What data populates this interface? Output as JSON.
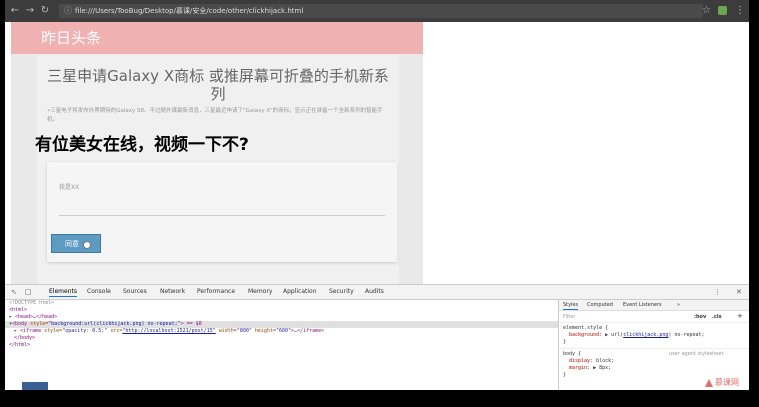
{
  "browser": {
    "url": "file:///Users/TooBug/Desktop/慕课/安全/code/other/clickhijack.html",
    "back_icon": "arrow-left-icon",
    "forward_icon": "arrow-right-icon",
    "reload_icon": "reload-icon"
  },
  "page": {
    "logo": "昨日头条",
    "headline": "三星申请Galaxy X商标 或推屏幕可折叠的手机新系列",
    "summary": "•三星电子将发布外界期待的Galaxy S8。不过随外媒最新消息，三星最近申请了\"Galaxy X\"的商标，显示正在准备一个全新系列的智能手机。",
    "lure_text": "有位美女在线，视频一下不?",
    "form": {
      "field_label": "我是XX",
      "submit_label": "同意"
    }
  },
  "devtools": {
    "tabs": [
      "Elements",
      "Console",
      "Sources",
      "Network",
      "Performance",
      "Memory",
      "Application",
      "Security",
      "Audits"
    ],
    "active_tab": "Elements",
    "dom": {
      "doctype": "<!DOCTYPE html>",
      "html_open": "<html>",
      "head": "<head>…</head>",
      "body_tag": "<body",
      "body_attr": "style=",
      "body_val": "\"background:url(clickhijack.png) no-repeat;\"",
      "body_end": "> == $0",
      "iframe_tag": "<iframe",
      "iframe_style_attr": "style=",
      "iframe_style_val": "\"opacity: 0.5;\"",
      "iframe_src_attr": "src=",
      "iframe_src_val": "\"http://localhost:1521/post/15\"",
      "iframe_width_attr": "width=",
      "iframe_width_val": "\"800\"",
      "iframe_height_attr": "height=",
      "iframe_height_val": "\"600\"",
      "iframe_end": ">…</iframe>",
      "body_close": "</body>",
      "html_close": "</html>"
    },
    "styles_panel": {
      "tabs": [
        "Styles",
        "Computed",
        "Event Listeners",
        "»"
      ],
      "filter_placeholder": "Filter",
      "hov": ":hov",
      "cls": ".cls",
      "plus": "+",
      "element_style_selector": "element.style {",
      "bg_prop": "background",
      "bg_prefix": ": ▶ url(",
      "bg_link": "clickhijack.png",
      "bg_suffix": ") no-repeat;",
      "close_brace": "}",
      "body_selector": "body {",
      "ua_label": "user agent stylesheet",
      "display_prop": "display",
      "display_val": ": block;",
      "margin_prop": "margin",
      "margin_val": ": ▶ 8px;"
    }
  },
  "watermark": "慕课网"
}
